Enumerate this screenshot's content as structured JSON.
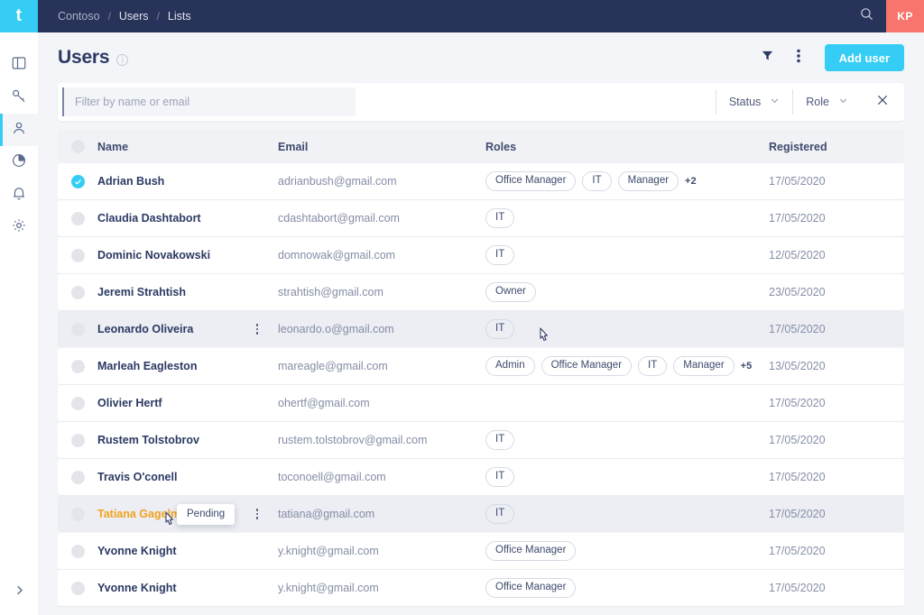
{
  "brand": {
    "logo_letter": "t",
    "accent": "#35cdf5",
    "topbar_bg": "#273359",
    "avatar_bg": "#f8756d"
  },
  "topbar": {
    "breadcrumb": [
      {
        "label": "Contoso"
      },
      {
        "label": "Users"
      },
      {
        "label": "Lists"
      }
    ],
    "separator": "/",
    "search_icon": "search-icon",
    "avatar_initials": "KP"
  },
  "sidebar": {
    "items": [
      {
        "name": "dashboard",
        "icon": "layout-icon",
        "active": false
      },
      {
        "name": "keys",
        "icon": "key-icon",
        "active": false
      },
      {
        "name": "users",
        "icon": "person-icon",
        "active": true
      },
      {
        "name": "reports",
        "icon": "pie-chart-icon",
        "active": false
      },
      {
        "name": "notifications",
        "icon": "bell-icon",
        "active": false
      },
      {
        "name": "settings",
        "icon": "gear-icon",
        "active": false
      }
    ],
    "expand_icon": "chevron-right-icon"
  },
  "page": {
    "title": "Users",
    "info_icon": "info-icon",
    "filter_icon": "funnel-icon",
    "overflow_icon": "vertical-dots-icon",
    "add_button": "Add user"
  },
  "filters": {
    "search_placeholder": "Filter by name or email",
    "search_value": "",
    "status": {
      "label": "Status",
      "chevron": "chevron-down-icon"
    },
    "role": {
      "label": "Role",
      "chevron": "chevron-down-icon"
    },
    "close_icon": "close-icon"
  },
  "table": {
    "columns": {
      "name": "Name",
      "email": "Email",
      "roles": "Roles",
      "registered": "Registered"
    },
    "rows": [
      {
        "name": "Adrian Bush",
        "email": "adrianbush@gmail.com",
        "roles": [
          "Office Manager",
          "IT",
          "Manager"
        ],
        "more": "+2",
        "date": "17/05/2020",
        "selected": true,
        "hover": false,
        "pending": false
      },
      {
        "name": "Claudia Dashtabort",
        "email": "cdashtabort@gmail.com",
        "roles": [
          "IT"
        ],
        "more": "",
        "date": "17/05/2020",
        "selected": false,
        "hover": false,
        "pending": false
      },
      {
        "name": "Dominic Novakowski",
        "email": "domnowak@gmail.com",
        "roles": [
          "IT"
        ],
        "more": "",
        "date": "12/05/2020",
        "selected": false,
        "hover": false,
        "pending": false
      },
      {
        "name": "Jeremi Strahtish",
        "email": "strahtish@gmail.com",
        "roles": [
          "Owner"
        ],
        "more": "",
        "date": "23/05/2020",
        "selected": false,
        "hover": false,
        "pending": false
      },
      {
        "name": "Leonardo Oliveira",
        "email": "leonardo.o@gmail.com",
        "roles": [
          "IT"
        ],
        "more": "",
        "date": "17/05/2020",
        "selected": false,
        "hover": true,
        "pending": false
      },
      {
        "name": "Marleah Eagleston",
        "email": "mareagle@gmail.com",
        "roles": [
          "Admin",
          "Office Manager",
          "IT",
          "Manager"
        ],
        "more": "+5",
        "date": "13/05/2020",
        "selected": false,
        "hover": false,
        "pending": false
      },
      {
        "name": "Olivier Hertf",
        "email": "ohertf@gmail.com",
        "roles": [],
        "more": "",
        "date": "17/05/2020",
        "selected": false,
        "hover": false,
        "pending": false
      },
      {
        "name": "Rustem Tolstobrov",
        "email": "rustem.tolstobrov@gmail.com",
        "roles": [
          "IT"
        ],
        "more": "",
        "date": "17/05/2020",
        "selected": false,
        "hover": false,
        "pending": false
      },
      {
        "name": "Travis O'conell",
        "email": "toconoell@gmail.com",
        "roles": [
          "IT"
        ],
        "more": "",
        "date": "17/05/2020",
        "selected": false,
        "hover": false,
        "pending": false
      },
      {
        "name": "Tatiana Gagelman",
        "email": "tatiana@gmail.com",
        "roles": [
          "IT"
        ],
        "more": "",
        "date": "17/05/2020",
        "selected": false,
        "hover": true,
        "pending": true
      },
      {
        "name": "Yvonne Knight",
        "email": "y.knight@gmail.com",
        "roles": [
          "Office Manager"
        ],
        "more": "",
        "date": "17/05/2020",
        "selected": false,
        "hover": false,
        "pending": false
      },
      {
        "name": "Yvonne Knight",
        "email": "y.knight@gmail.com",
        "roles": [
          "Office Manager"
        ],
        "more": "",
        "date": "17/05/2020",
        "selected": false,
        "hover": false,
        "pending": false
      }
    ]
  },
  "tooltip": {
    "text": "Pending"
  }
}
